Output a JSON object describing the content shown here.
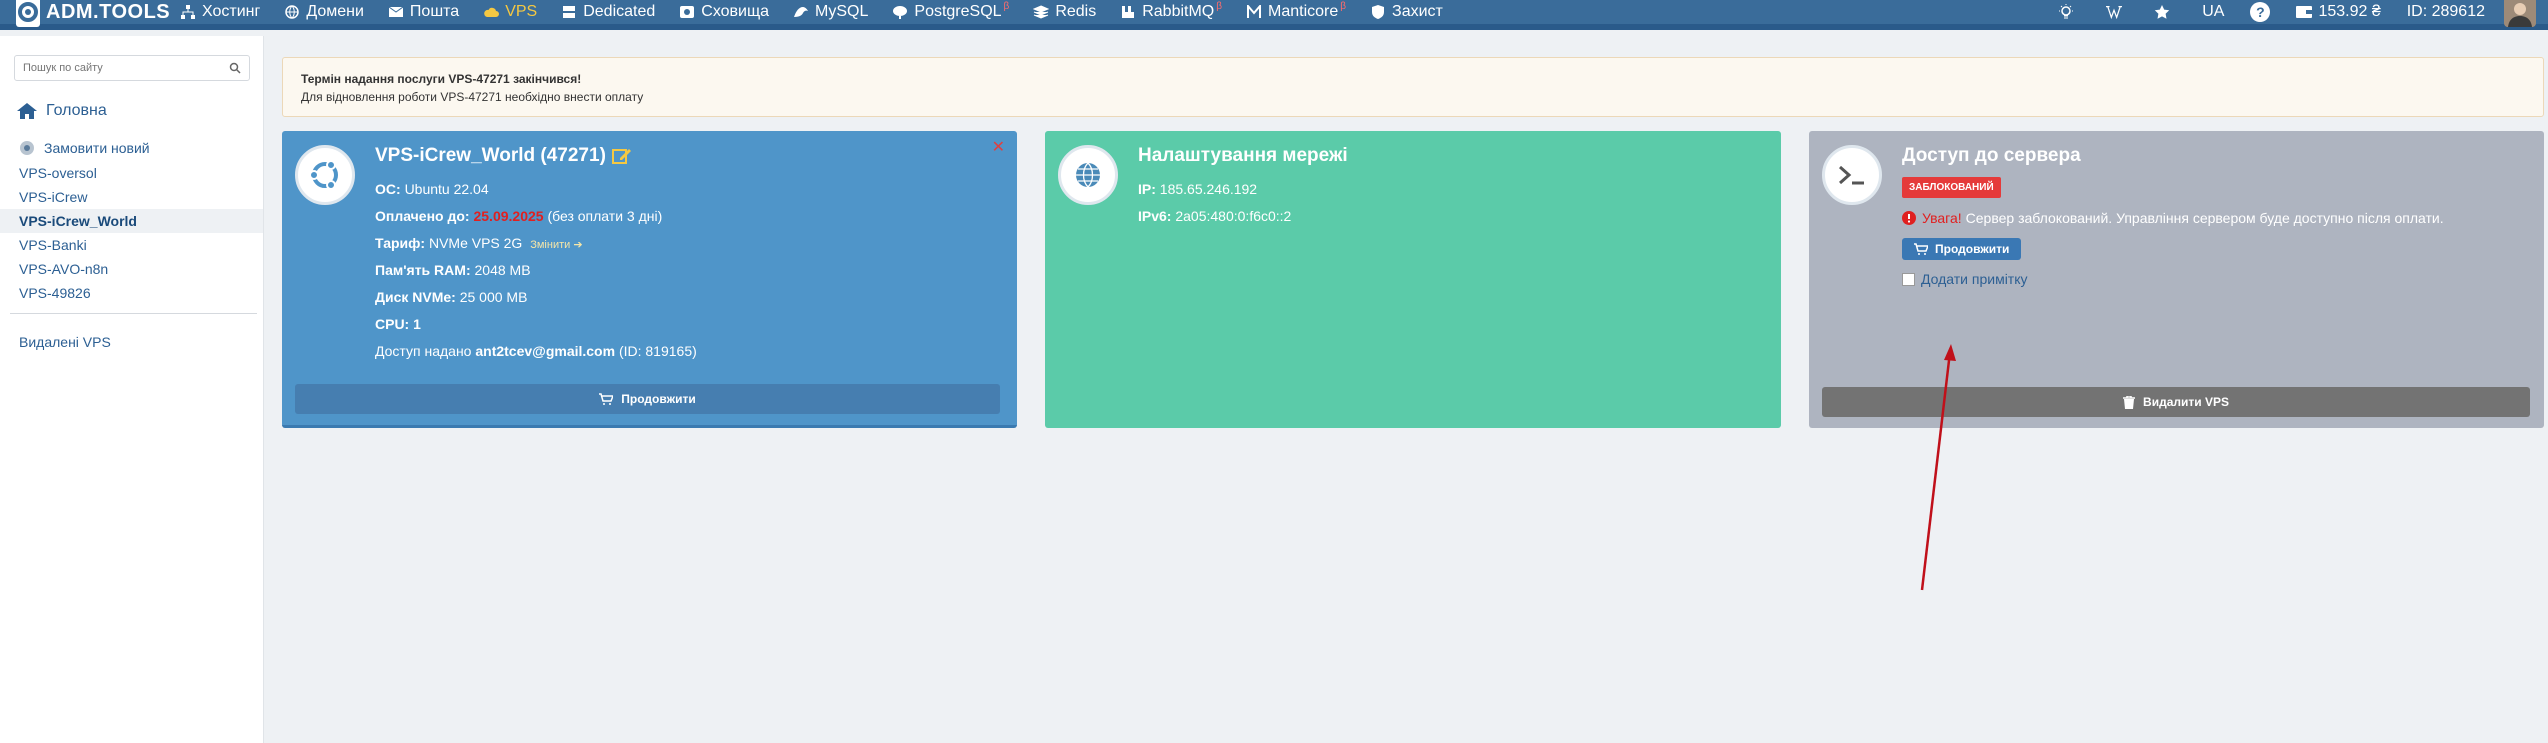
{
  "nav": {
    "brand": "ADM.TOOLS",
    "items": [
      {
        "label": "Хостинг",
        "icon": "sitemap-icon"
      },
      {
        "label": "Домени",
        "icon": "globe-icon"
      },
      {
        "label": "Пошта",
        "icon": "envelope-icon"
      },
      {
        "label": "VPS",
        "icon": "cloud-icon",
        "active": true
      },
      {
        "label": "Dedicated",
        "icon": "server-icon"
      },
      {
        "label": "Сховища",
        "icon": "storage-icon"
      },
      {
        "label": "MySQL",
        "icon": "mysql-icon"
      },
      {
        "label": "PostgreSQL",
        "icon": "postgres-icon",
        "badge": "β"
      },
      {
        "label": "Redis",
        "icon": "redis-icon"
      },
      {
        "label": "RabbitMQ",
        "icon": "rabbit-icon",
        "badge": "β"
      },
      {
        "label": "Manticore",
        "icon": "manticore-icon",
        "badge": "β"
      },
      {
        "label": "Захист",
        "icon": "shield-icon"
      }
    ],
    "right": {
      "lang": "UA",
      "balance": "153.92 ₴",
      "account_id": "ID: 289612"
    }
  },
  "sidebar": {
    "search_placeholder": "Пошук по сайту",
    "home": "Головна",
    "order_new": "Замовити новий",
    "vps_items": [
      "VPS-oversol",
      "VPS-iCrew",
      "VPS-iCrew_World",
      "VPS-Banki",
      "VPS-AVO-n8n",
      "VPS-49826"
    ],
    "current_vps": "VPS-iCrew_World",
    "deleted": "Видалені VPS"
  },
  "alert": {
    "title": "Термін надання послуги VPS-47271 закінчився!",
    "text": "Для відновлення роботи VPS-47271 необхідно внести оплату"
  },
  "vps_card": {
    "title": "VPS-iCrew_World (47271)",
    "os_label": "ОС:",
    "os_value": "Ubuntu 22.04",
    "paid_label": "Оплачено до:",
    "paid_date": "25.09.2025",
    "paid_note": "(без оплати 3 дні)",
    "tariff_label": "Тариф:",
    "tariff_value": "NVMe VPS 2G",
    "tariff_change": "Змінити",
    "ram_label": "Пам'ять RAM:",
    "ram_value": "2048 MB",
    "disk_label": "Диск NVMe:",
    "disk_value": "25 000 MB",
    "cpu_label": "CPU:",
    "cpu_value": "1",
    "access_label": "Доступ надано",
    "access_email": "ant2tcev@gmail.com",
    "access_id": "(ID: 819165)",
    "extend_button": "Продовжити"
  },
  "network_card": {
    "title": "Налаштування мережі",
    "ip_label": "IP:",
    "ip_value": "185.65.246.192",
    "ipv6_label": "IPv6:",
    "ipv6_value": "2a05:480:0:f6c0::2"
  },
  "access_card": {
    "title": "Доступ до сервера",
    "badge": "ЗАБЛОКОВАНИЙ",
    "warning_label": "Увага!",
    "warning_text": "Сервер заблокований. Управління сервером буде доступно після оплати.",
    "extend_button": "Продовжити",
    "add_note": "Додати примітку",
    "delete_button": "Видалити VPS"
  },
  "colors": {
    "topbar": "#3a6c9a",
    "vps_card": "#4f95c9",
    "network_card": "#5bcba9",
    "access_card": "#aeb4c0",
    "blocked_badge": "#e53a3a",
    "annotation_arrow": "#c0101a"
  }
}
